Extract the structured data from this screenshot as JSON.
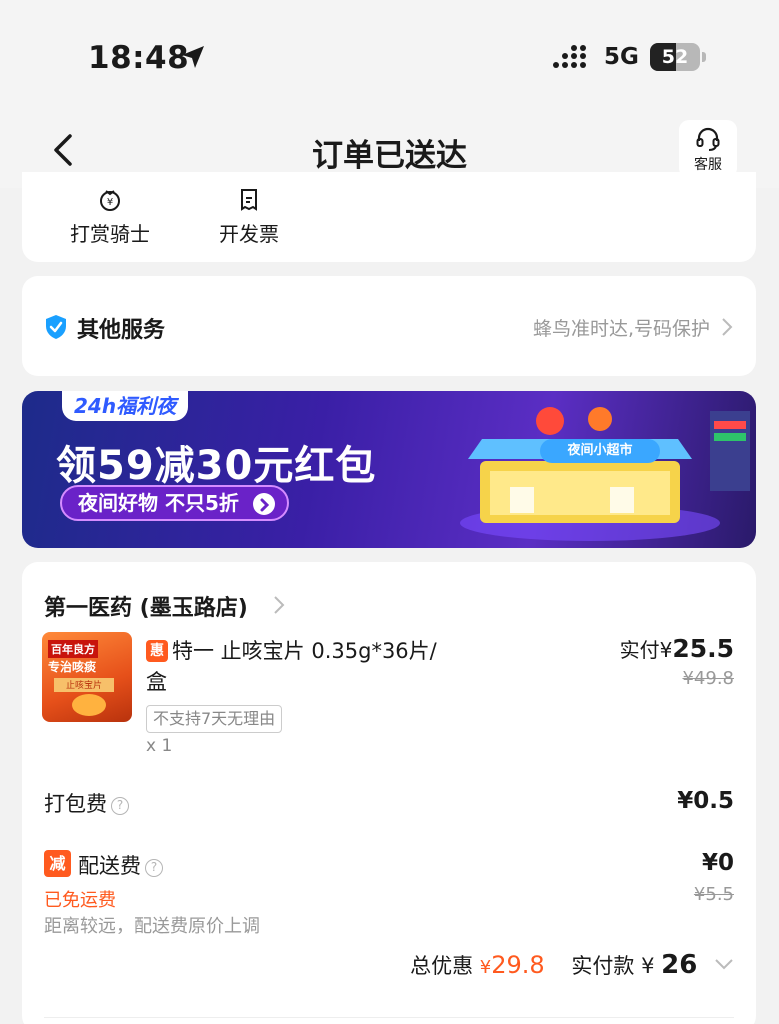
{
  "status_bar": {
    "time": "18:48",
    "network": "5G",
    "battery": "52",
    "battery_level": 0.52
  },
  "nav": {
    "title": "订单已送达",
    "customer_service": "客服"
  },
  "actions": [
    {
      "label": "打赏骑士",
      "icon": "yen-bag-icon"
    },
    {
      "label": "开发票",
      "icon": "receipt-icon"
    }
  ],
  "services": {
    "title": "其他服务",
    "detail": "蜂鸟准时达,号码保护"
  },
  "banner": {
    "tag": "24h福利夜",
    "headline": "领59减30元红包",
    "cta": "夜间好物 不只5折",
    "store_sign": "夜间小超市"
  },
  "order": {
    "shop_name": "第一医药 (墨玉路店)",
    "product": {
      "badge": "惠",
      "name": "特一 止咳宝片 0.35g*36片/盒",
      "tag": "不支持7天无理由",
      "qty": "x 1",
      "paid_label": "实付¥",
      "paid_amount": "25.5",
      "original_price": "¥49.8",
      "thumb_text": [
        "百年良方",
        "专治咳痰",
        "止咳宝片"
      ]
    },
    "packing_fee": {
      "label": "打包费",
      "value": "¥0.5"
    },
    "delivery_fee": {
      "badge": "减",
      "label": "配送费",
      "value": "¥0",
      "original": "¥5.5",
      "free_text": "已免运费",
      "note": "距离较远，配送费原价上调"
    },
    "totals": {
      "discount_label": "总优惠",
      "discount_currency": "¥",
      "discount_amount": "29.8",
      "paid_label": "实付款",
      "paid_currency": "¥",
      "paid_amount": "26"
    }
  }
}
